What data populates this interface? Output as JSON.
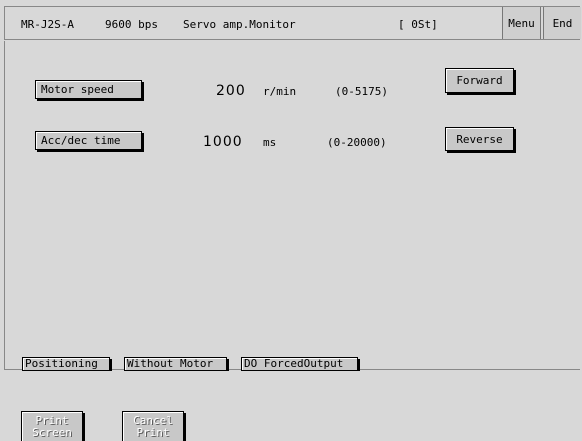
{
  "titlebar": {
    "model": "MR-J2S-A",
    "baud": "9600 bps",
    "screen": "Servo amp.Monitor",
    "station": "[ 0St]",
    "menu_label": "Menu",
    "end_label": "End"
  },
  "params": {
    "speed": {
      "label": "Motor speed",
      "value": "200",
      "unit": "r/min",
      "range": "(0-5175)"
    },
    "acc": {
      "label": "Acc/dec time",
      "value": "1000",
      "unit": "ms",
      "range": "(0-20000)"
    }
  },
  "actions": {
    "forward": "Forward",
    "reverse": "Reverse"
  },
  "modes": {
    "positioning": "Positioning",
    "without_motor": "Without Motor",
    "do_forced": "DO ForcedOutput"
  },
  "bottom": {
    "print": "Print\nScreen",
    "cancel_print": "Cancel\nPrint"
  }
}
